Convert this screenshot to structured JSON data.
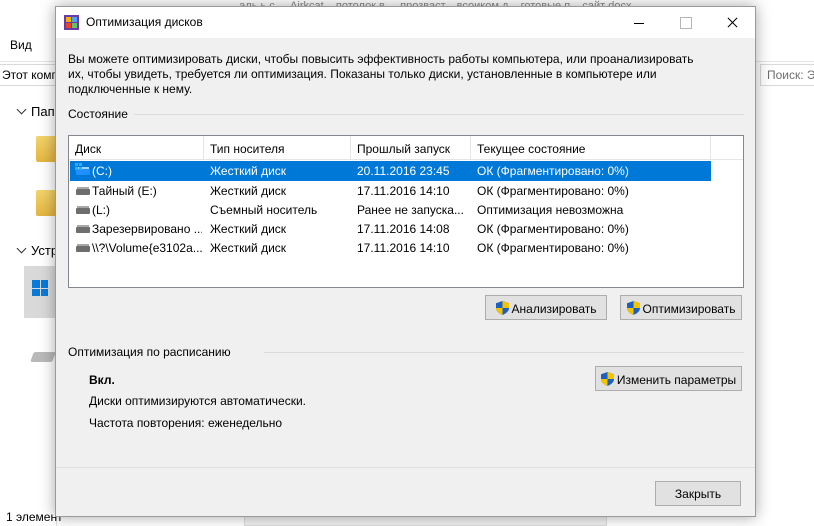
{
  "background": {
    "view_tab": "Вид",
    "faint_text": "...аль ь с ...     Аirkcat...     потолок в ...     прозваст...     всоиком д...     готовые п...     сайт docx",
    "address_text": "Этот компьютер",
    "search_placeholder": "Поиск: Этот компьютер",
    "nav_items": [
      "Папки",
      "Устройства и диски"
    ],
    "status_text": "1 элемент"
  },
  "dialog": {
    "title": "Оптимизация дисков",
    "description": "Вы можете оптимизировать диски, чтобы повысить эффективность работы  компьютера, или проанализировать\nих, чтобы увидеть, требуется ли оптимизация. Показаны только диски, установленные в компьютере или\nподключенные к нему.",
    "status_group_label": "Состояние",
    "columns": [
      "Диск",
      "Тип носителя",
      "Прошлый запуск",
      "Текущее состояние"
    ],
    "drives": [
      {
        "name": "(C:)",
        "media": "Жесткий диск",
        "last_run": "20.11.2016 23:45",
        "status": "ОК (Фрагментировано: 0%)",
        "icon": "system-drive-icon"
      },
      {
        "name": "Тайный (E:)",
        "media": "Жесткий диск",
        "last_run": "17.11.2016 14:10",
        "status": "ОК (Фрагментировано: 0%)",
        "icon": "hard-drive-icon"
      },
      {
        "name": "(L:)",
        "media": "Съемный носитель",
        "last_run": "Ранее не запуска...",
        "status": "Оптимизация невозможна",
        "icon": "removable-drive-icon"
      },
      {
        "name": "Зарезервировано ...",
        "media": "Жесткий диск",
        "last_run": "17.11.2016 14:08",
        "status": "ОК (Фрагментировано: 0%)",
        "icon": "hard-drive-icon"
      },
      {
        "name": "\\\\?\\Volume{e3102a...",
        "media": "Жесткий диск",
        "last_run": "17.11.2016 14:10",
        "status": "ОК (Фрагментировано: 0%)",
        "icon": "hard-drive-icon"
      }
    ],
    "analyze_label": "Анализировать",
    "optimize_label": "Оптимизировать",
    "schedule_group_label": "Оптимизация по расписанию",
    "schedule_state": "Вкл.",
    "schedule_auto": "Диски оптимизируются автоматически.",
    "schedule_frequency": "Частота повторения: еженедельно",
    "change_settings_label": "Изменить параметры",
    "close_label": "Закрыть"
  }
}
